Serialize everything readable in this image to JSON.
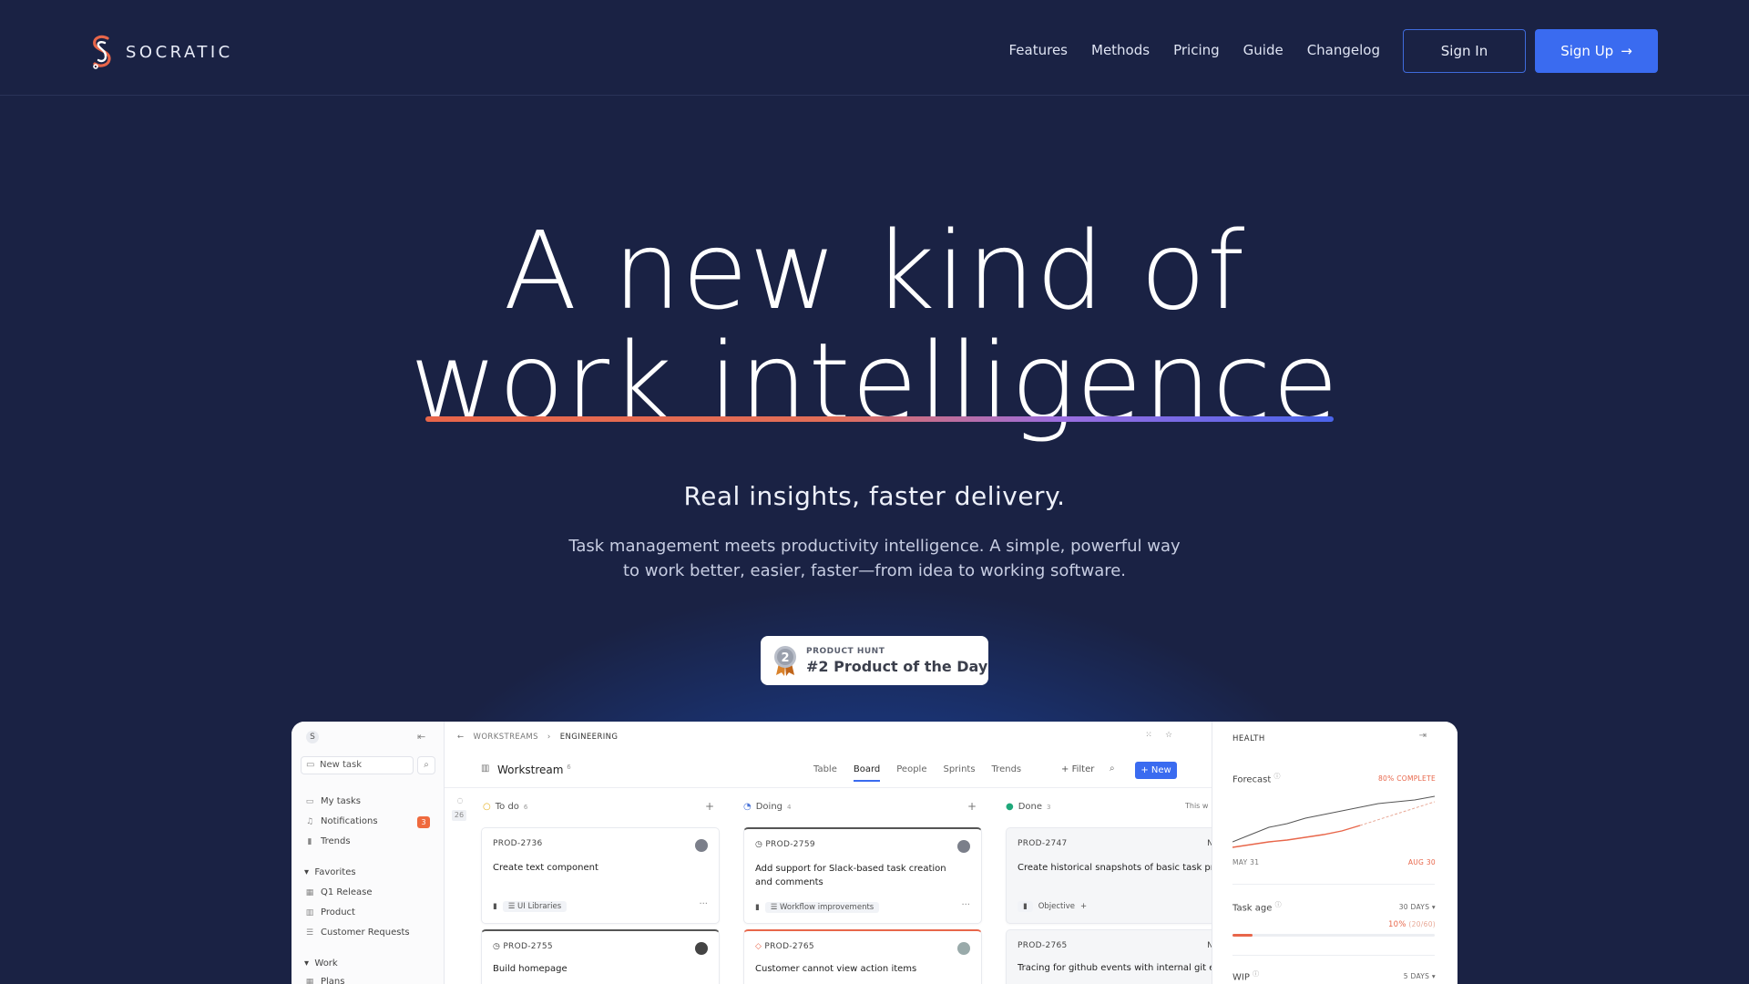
{
  "colors": {
    "bg": "#1a2244",
    "accent": "#3a6bf0",
    "orange": "#e8664a"
  },
  "nav": {
    "brand": "SOCRATIC",
    "links": [
      "Features",
      "Methods",
      "Pricing",
      "Guide",
      "Changelog"
    ],
    "sign_in": "Sign In",
    "sign_up": "Sign Up"
  },
  "hero": {
    "line1": "A new kind of",
    "line2": "work intelligence",
    "subtitle": "Real insights, faster delivery.",
    "description_1": "Task management meets productivity intelligence. A simple, powerful way",
    "description_2": "to work better, easier, faster—from idea to working software."
  },
  "badge": {
    "medal_number": "2",
    "source": "PRODUCT HUNT",
    "text": "#2 Product of the Day"
  },
  "app": {
    "sidebar": {
      "logo_letter": "S",
      "new_task": "New task",
      "items": [
        {
          "label": "My tasks",
          "icon": "inbox-icon"
        },
        {
          "label": "Notifications",
          "icon": "bell-icon",
          "badge": "3"
        },
        {
          "label": "Trends",
          "icon": "bar-chart-icon"
        }
      ],
      "favorites_heading": "Favorites",
      "favorites": [
        {
          "label": "Q1 Release",
          "icon": "table-icon"
        },
        {
          "label": "Product",
          "icon": "board-icon"
        },
        {
          "label": "Customer Requests",
          "icon": "list-icon"
        }
      ],
      "work_heading": "Work",
      "work": [
        {
          "label": "Plans",
          "icon": "table-icon"
        }
      ]
    },
    "main": {
      "breadcrumb": [
        "WORKSTREAMS",
        "ENGINEERING"
      ],
      "title": "Workstream",
      "title_count": "6",
      "tabs": [
        "Table",
        "Board",
        "People",
        "Sprints",
        "Trends"
      ],
      "active_tab": "Board",
      "filter": "Filter",
      "new_button": "New",
      "left_count": "26",
      "columns": [
        {
          "name": "To do",
          "count": "6",
          "cards": [
            {
              "id": "PROD-2736",
              "title": "Create text component",
              "tag": "UI Libraries"
            },
            {
              "id": "PROD-2755",
              "title": "Build homepage"
            }
          ]
        },
        {
          "name": "Doing",
          "count": "4",
          "cards": [
            {
              "id": "PROD-2759",
              "title": "Add support for Slack-based task creation and comments",
              "tag": "Workflow improvements"
            },
            {
              "id": "PROD-2765",
              "title": "Customer cannot view action items"
            }
          ]
        },
        {
          "name": "Done",
          "count": "3",
          "extra": "This w",
          "cards": [
            {
              "id": "PROD-2747",
              "id_right": "NO",
              "title": "Create historical snapshots of basic task proper",
              "tag": "Objective"
            },
            {
              "id": "PROD-2765",
              "id_right": "NO",
              "title": "Tracing for github events with internal git even"
            }
          ]
        }
      ]
    },
    "health": {
      "heading": "HEALTH",
      "forecast_label": "Forecast",
      "forecast_status": "80% COMPLETE",
      "date_start": "MAY 31",
      "date_end": "AUG 30",
      "task_age_label": "Task age",
      "task_age_range": "30 DAYS",
      "task_age_value": "10%",
      "task_age_detail": "(20/60)",
      "task_age_fraction": 0.1,
      "wip_label": "WIP",
      "wip_range": "5 DAYS"
    }
  }
}
